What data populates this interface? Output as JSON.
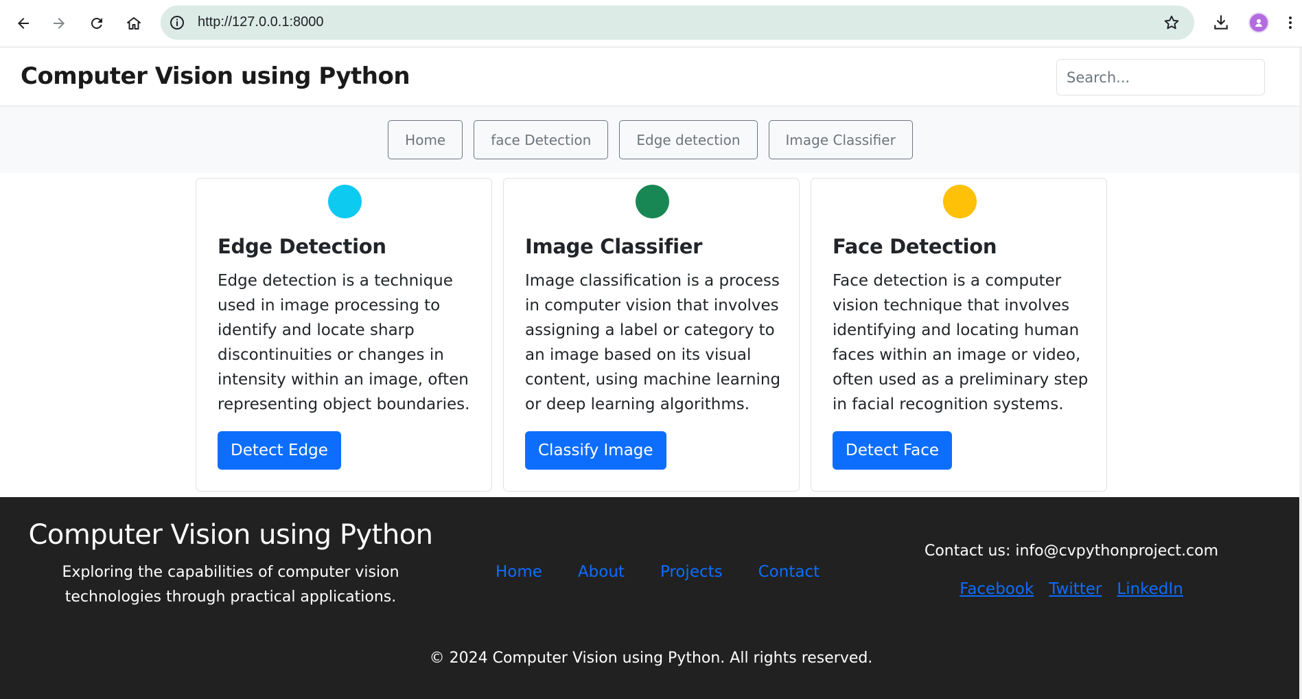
{
  "browser": {
    "url": "http://127.0.0.1:8000",
    "icons": [
      "back-icon",
      "forward-icon",
      "reload-icon",
      "home-icon",
      "site-info-icon",
      "bookmark-star-icon",
      "download-icon",
      "profile-avatar",
      "more-menu-icon"
    ]
  },
  "header": {
    "title": "Computer Vision using Python",
    "search_placeholder": "Search..."
  },
  "nav": {
    "items": [
      {
        "label": "Home"
      },
      {
        "label": "face Detection"
      },
      {
        "label": "Edge detection"
      },
      {
        "label": "Image Classifier"
      }
    ]
  },
  "cards": [
    {
      "title": "Edge Detection",
      "text": "Edge detection is a technique used in image processing to identify and locate sharp discontinuities or changes in intensity within an image, often representing object boundaries.",
      "button": "Detect Edge",
      "dot_color": "#0dcaf0"
    },
    {
      "title": "Image Classifier",
      "text": "Image classification is a process in computer vision that involves assigning a label or category to an image based on its visual content, using machine learning or deep learning algorithms.",
      "button": "Classify Image",
      "dot_color": "#198754"
    },
    {
      "title": "Face Detection",
      "text": "Face detection is a computer vision technique that involves identifying and locating human faces within an image or video, often used as a preliminary step in facial recognition systems.",
      "button": "Detect Face",
      "dot_color": "#ffc107"
    }
  ],
  "footer": {
    "title": "Computer Vision using Python",
    "tagline": "Exploring the capabilities of computer vision technologies through practical applications.",
    "links": [
      "Home",
      "About",
      "Projects",
      "Contact"
    ],
    "contact": "Contact us: info@cvpythonproject.com",
    "social": [
      "Facebook",
      "Twitter",
      "LinkedIn"
    ],
    "copyright": "© 2024 Computer Vision using Python. All rights reserved."
  },
  "colors": {
    "primary": "#0d6efd",
    "footer_bg": "#212121",
    "urlbar_bg": "#dcebe6"
  }
}
